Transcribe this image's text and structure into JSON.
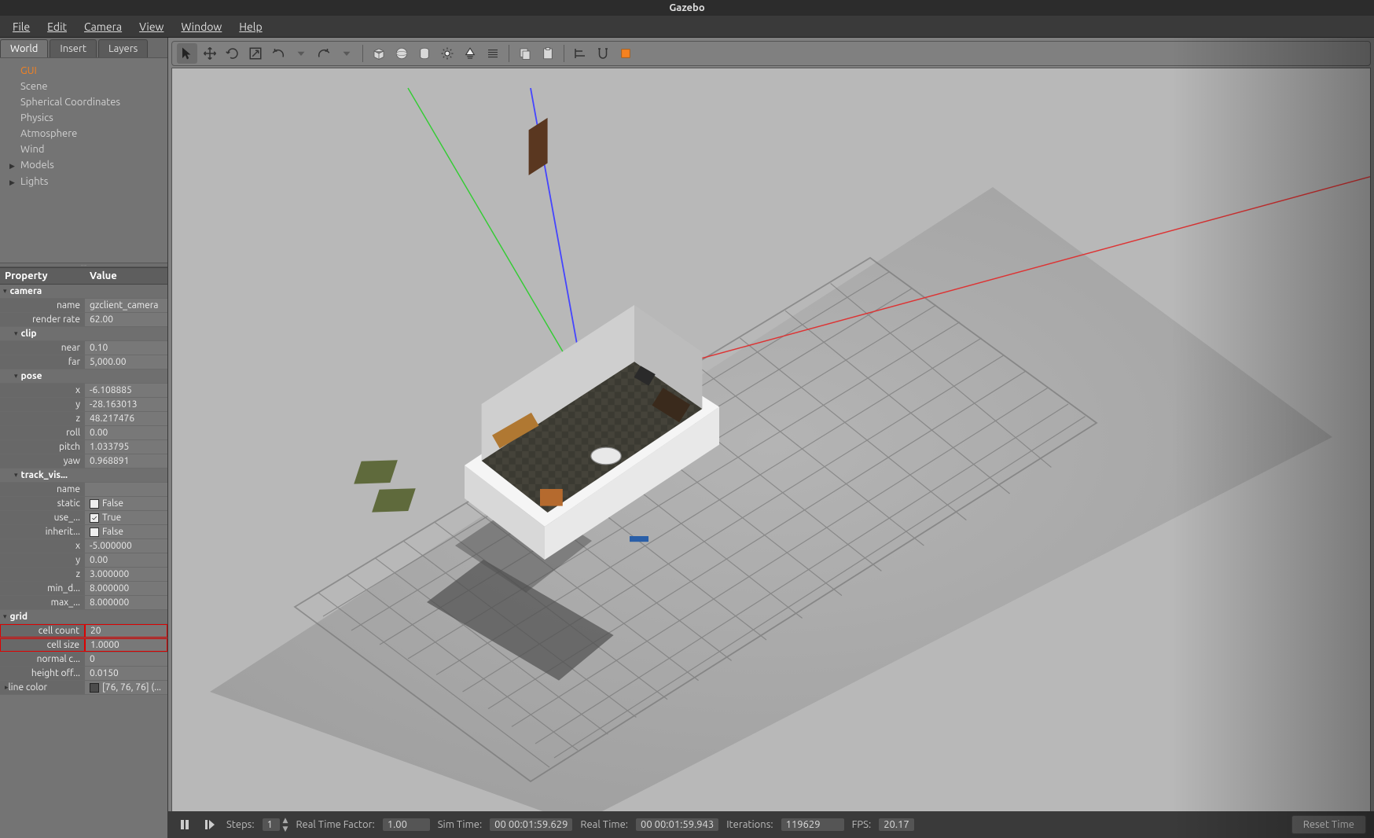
{
  "app": {
    "title": "Gazebo"
  },
  "menu": {
    "file": "File",
    "edit": "Edit",
    "camera": "Camera",
    "view": "View",
    "window": "Window",
    "help": "Help"
  },
  "tabs": {
    "world": "World",
    "insert": "Insert",
    "layers": "Layers"
  },
  "tree": {
    "items": [
      {
        "label": "GUI",
        "sel": true
      },
      {
        "label": "Scene"
      },
      {
        "label": "Spherical Coordinates"
      },
      {
        "label": "Physics"
      },
      {
        "label": "Atmosphere"
      },
      {
        "label": "Wind"
      },
      {
        "label": "Models",
        "exp": true
      },
      {
        "label": "Lights",
        "exp": true
      }
    ]
  },
  "props": {
    "header": {
      "property": "Property",
      "value": "Value"
    },
    "rows": [
      {
        "type": "section",
        "label": "camera"
      },
      {
        "k": "name",
        "v": "gzclient_camera"
      },
      {
        "k": "render rate",
        "v": "62.00"
      },
      {
        "type": "section",
        "label": "clip",
        "indent": 1
      },
      {
        "k": "near",
        "v": "0.10"
      },
      {
        "k": "far",
        "v": "5,000.00"
      },
      {
        "type": "section",
        "label": "pose",
        "indent": 1
      },
      {
        "k": "x",
        "v": "-6.108885"
      },
      {
        "k": "y",
        "v": "-28.163013"
      },
      {
        "k": "z",
        "v": "48.217476"
      },
      {
        "k": "roll",
        "v": "0.00"
      },
      {
        "k": "pitch",
        "v": "1.033795"
      },
      {
        "k": "yaw",
        "v": "0.968891"
      },
      {
        "type": "section",
        "label": "track_vis...",
        "indent": 1
      },
      {
        "k": "name",
        "v": ""
      },
      {
        "k": "static",
        "v": "False",
        "cb": false
      },
      {
        "k": "use_...",
        "v": "True",
        "cb": true
      },
      {
        "k": "inherit...",
        "v": "False",
        "cb": false
      },
      {
        "k": "x",
        "v": "-5.000000"
      },
      {
        "k": "y",
        "v": "0.00"
      },
      {
        "k": "z",
        "v": "3.000000"
      },
      {
        "k": "min_d...",
        "v": "8.000000"
      },
      {
        "k": "max_...",
        "v": "8.000000"
      },
      {
        "type": "section",
        "label": "grid"
      },
      {
        "k": "cell count",
        "v": "20",
        "hl": true
      },
      {
        "k": "cell size",
        "v": "1.0000",
        "hl": true
      },
      {
        "k": "normal c...",
        "v": "0"
      },
      {
        "k": "height off...",
        "v": "0.0150"
      },
      {
        "k": "line color",
        "v": "[76, 76, 76] (...",
        "swatch": true,
        "exp": true
      }
    ]
  },
  "toolbar_icons": [
    "select",
    "move",
    "rotate",
    "scale",
    "undo",
    "redo",
    "|",
    "box",
    "sphere",
    "cylinder",
    "light-point",
    "light-directional",
    "light-spot",
    "|",
    "copy",
    "paste",
    "|",
    "snap-align",
    "snap",
    "highlight"
  ],
  "status": {
    "steps_label": "Steps:",
    "steps_value": "1",
    "rtf_label": "Real Time Factor:",
    "rtf_value": "1.00",
    "simtime_label": "Sim Time:",
    "simtime_value": "00 00:01:59.629",
    "realtime_label": "Real Time:",
    "realtime_value": "00 00:01:59.943",
    "iter_label": "Iterations:",
    "iter_value": " 119629",
    "fps_label": "FPS:",
    "fps_value": "20.17",
    "reset": "Reset Time"
  }
}
